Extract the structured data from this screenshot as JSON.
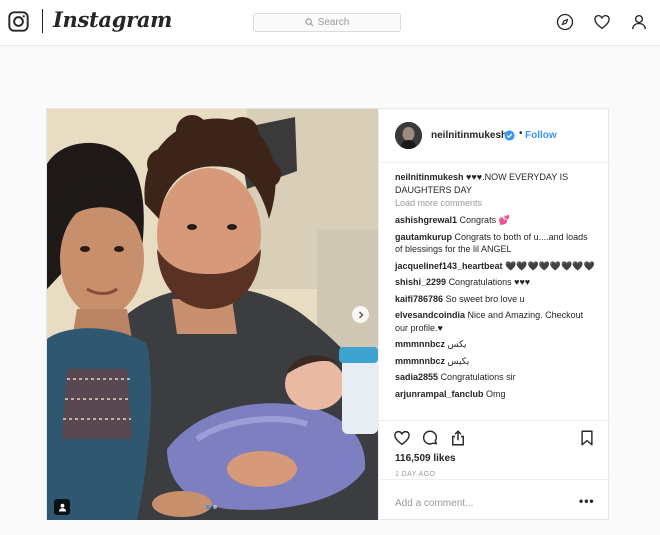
{
  "nav": {
    "wordmark": "Instagram",
    "search_placeholder": "Search",
    "icons": [
      "instagram-camera-icon",
      "explore-compass-icon",
      "activity-heart-icon",
      "profile-icon"
    ]
  },
  "post": {
    "header": {
      "username": "neilnitinmukesh",
      "follow_label": "Follow",
      "separator": "•",
      "verified": true
    },
    "caption": {
      "username": "neilnitinmukesh",
      "text": "♥♥♥.NOW EVERYDAY IS DAUGHTERS DAY"
    },
    "load_more_label": "Load more comments",
    "comments": [
      {
        "user": "ashishgrewal1",
        "text": "Congrats 💕"
      },
      {
        "user": "gautamkurup",
        "text": "Congrats to both of u....and loads of blessings for the lil ANGEL"
      },
      {
        "user": "jacquelinef143_heartbeat",
        "text": "🖤🖤🖤🖤🖤🖤🖤🖤"
      },
      {
        "user": "shishi_2299",
        "text": "Congratulations ♥♥♥"
      },
      {
        "user": "kaifi786786",
        "text": "So sweet bro love u"
      },
      {
        "user": "elvesandcoindia",
        "text": "Nice and Amazing. Checkout our profile.♥"
      },
      {
        "user": "mmmnnbcz",
        "text": "یکس"
      },
      {
        "user": "mmmnnbcz",
        "text": "یکیس"
      },
      {
        "user": "sadia2855",
        "text": "Congratulations sir"
      },
      {
        "user": "arjunrampal_fanclub",
        "text": "Omg"
      }
    ],
    "likes_label": "116,509 likes",
    "time_label": "1 DAY AGO",
    "add_comment_placeholder": "Add a comment...",
    "more_options_label": "•••",
    "carousel": {
      "count": 2,
      "active": 0
    },
    "accent_color": "#3897f0"
  }
}
